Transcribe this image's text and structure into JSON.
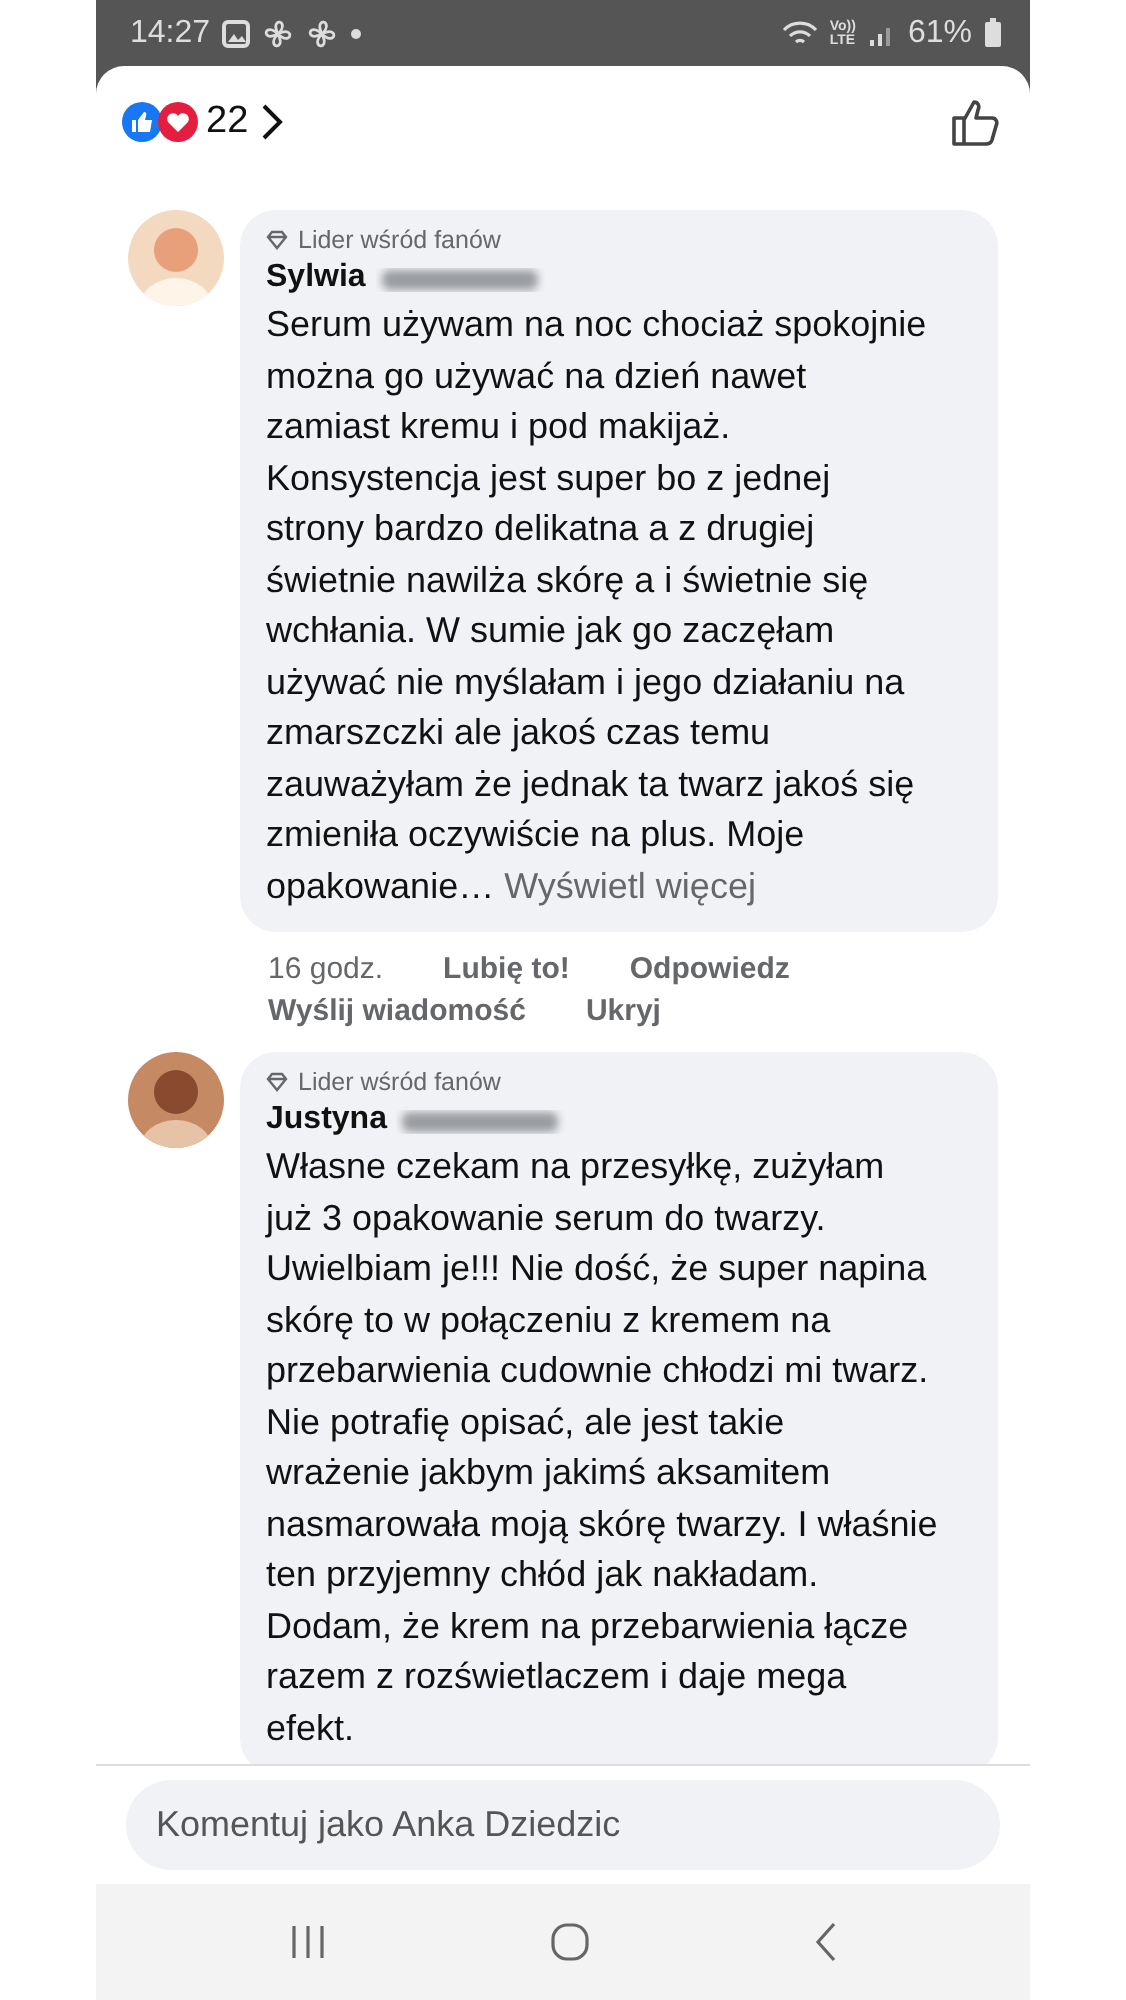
{
  "status_bar": {
    "time": "14:27",
    "volte_top": "Vo))",
    "volte_bottom": "LTE",
    "battery": "61%"
  },
  "header": {
    "reaction_count": "22"
  },
  "comments": [
    {
      "badge": "Lider wśród fanów",
      "name": "Sylwia",
      "text": "Serum używam na noc chociaż spokojnie można go używać na dzień nawet zamiast kremu i pod makijaż. Konsystencja jest super bo z jednej strony bardzo delikatna a z drugiej świetnie nawilża skórę a i świetnie się wchłania. W sumie jak go zaczęłam używać nie myślałam i jego działaniu na zmarszczki ale jakoś czas temu zauważyłam że jednak ta twarz jakoś się zmieniła oczywiście na plus. Moje opakowanie…",
      "see_more": "Wyświetl więcej",
      "time": "16 godz.",
      "actions": [
        "Lubię to!",
        "Odpowiedz",
        "Wyślij wiadomość",
        "Ukryj"
      ]
    },
    {
      "badge": "Lider wśród fanów",
      "name": "Justyna",
      "text": "Własne czekam na przesyłkę, zużyłam już 3 opakowanie serum do twarzy. Uwielbiam je!!! Nie dość, że super napina skórę to w połączeniu z kremem na przebarwienia cudownie chłodzi mi twarz. Nie potrafię opisać, ale jest takie wrażenie jakbym jakimś aksamitem nasmarowała moją skórę twarzy. I właśnie ten przyjemny chłód jak nakładam. Dodam, że krem na przebarwienia łącze razem z rozświetlaczem i daje mega efekt."
    }
  ],
  "comment_field": {
    "placeholder": "Komentuj jako Anka Dziedzic"
  }
}
